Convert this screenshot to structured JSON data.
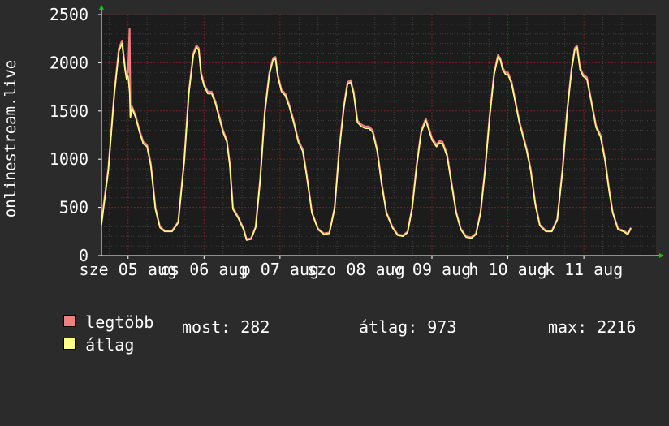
{
  "chart_data": {
    "type": "line",
    "ylabel": "onlinestream.live",
    "yticks": [
      0,
      500,
      1000,
      1500,
      2000,
      2500
    ],
    "ylim": [
      0,
      2500
    ],
    "xlim": [
      4.65,
      11.95
    ],
    "xtick_labels": [
      {
        "x": 5,
        "label": "sze 05 aug"
      },
      {
        "x": 6,
        "label": "cs 06 aug"
      },
      {
        "x": 7,
        "label": "p 07 aug"
      },
      {
        "x": 8,
        "label": "szo 08 aug"
      },
      {
        "x": 9,
        "label": "v 09 aug"
      },
      {
        "x": 10,
        "label": "h 10 aug"
      },
      {
        "x": 11,
        "label": "k 11 aug"
      }
    ],
    "grid": true,
    "colors": {
      "max": "#f08080",
      "avg": "#ffff88",
      "grid": "#7a2020",
      "axis": "#ffffff",
      "arrow": "#00cc00"
    },
    "series": [
      {
        "name": "legtöbb",
        "points": [
          [
            4.65,
            350
          ],
          [
            4.74,
            900
          ],
          [
            4.82,
            1700
          ],
          [
            4.88,
            2150
          ],
          [
            4.92,
            2230
          ],
          [
            4.96,
            1950
          ],
          [
            4.98,
            1850
          ],
          [
            5.0,
            1900
          ],
          [
            5.02,
            2350
          ],
          [
            5.03,
            1450
          ],
          [
            5.05,
            1550
          ],
          [
            5.1,
            1450
          ],
          [
            5.15,
            1300
          ],
          [
            5.2,
            1180
          ],
          [
            5.25,
            1150
          ],
          [
            5.3,
            950
          ],
          [
            5.36,
            500
          ],
          [
            5.42,
            300
          ],
          [
            5.48,
            260
          ],
          [
            5.58,
            260
          ],
          [
            5.66,
            350
          ],
          [
            5.74,
            1000
          ],
          [
            5.8,
            1700
          ],
          [
            5.86,
            2100
          ],
          [
            5.9,
            2180
          ],
          [
            5.93,
            2150
          ],
          [
            5.96,
            1900
          ],
          [
            6.0,
            1780
          ],
          [
            6.05,
            1700
          ],
          [
            6.1,
            1700
          ],
          [
            6.15,
            1600
          ],
          [
            6.2,
            1450
          ],
          [
            6.25,
            1300
          ],
          [
            6.3,
            1200
          ],
          [
            6.34,
            950
          ],
          [
            6.38,
            500
          ],
          [
            6.45,
            400
          ],
          [
            6.52,
            280
          ],
          [
            6.56,
            170
          ],
          [
            6.62,
            180
          ],
          [
            6.68,
            300
          ],
          [
            6.74,
            800
          ],
          [
            6.8,
            1500
          ],
          [
            6.86,
            1900
          ],
          [
            6.91,
            2050
          ],
          [
            6.94,
            2060
          ],
          [
            6.97,
            1880
          ],
          [
            7.02,
            1720
          ],
          [
            7.07,
            1680
          ],
          [
            7.12,
            1570
          ],
          [
            7.18,
            1400
          ],
          [
            7.24,
            1200
          ],
          [
            7.3,
            1100
          ],
          [
            7.35,
            850
          ],
          [
            7.42,
            450
          ],
          [
            7.5,
            280
          ],
          [
            7.58,
            230
          ],
          [
            7.65,
            240
          ],
          [
            7.72,
            500
          ],
          [
            7.78,
            1100
          ],
          [
            7.84,
            1550
          ],
          [
            7.89,
            1800
          ],
          [
            7.93,
            1820
          ],
          [
            7.97,
            1700
          ],
          [
            8.02,
            1400
          ],
          [
            8.07,
            1360
          ],
          [
            8.12,
            1340
          ],
          [
            8.17,
            1340
          ],
          [
            8.22,
            1300
          ],
          [
            8.28,
            1100
          ],
          [
            8.34,
            750
          ],
          [
            8.4,
            450
          ],
          [
            8.48,
            300
          ],
          [
            8.55,
            220
          ],
          [
            8.62,
            210
          ],
          [
            8.68,
            250
          ],
          [
            8.74,
            500
          ],
          [
            8.8,
            950
          ],
          [
            8.86,
            1300
          ],
          [
            8.92,
            1420
          ],
          [
            8.96,
            1320
          ],
          [
            9.0,
            1220
          ],
          [
            9.06,
            1150
          ],
          [
            9.1,
            1190
          ],
          [
            9.14,
            1180
          ],
          [
            9.2,
            1050
          ],
          [
            9.26,
            750
          ],
          [
            9.32,
            450
          ],
          [
            9.38,
            280
          ],
          [
            9.45,
            200
          ],
          [
            9.52,
            190
          ],
          [
            9.58,
            230
          ],
          [
            9.64,
            450
          ],
          [
            9.7,
            900
          ],
          [
            9.76,
            1450
          ],
          [
            9.82,
            1900
          ],
          [
            9.87,
            2080
          ],
          [
            9.9,
            2050
          ],
          [
            9.93,
            1950
          ],
          [
            9.97,
            1900
          ],
          [
            10.0,
            1900
          ],
          [
            10.05,
            1800
          ],
          [
            10.1,
            1600
          ],
          [
            10.15,
            1400
          ],
          [
            10.2,
            1250
          ],
          [
            10.25,
            1100
          ],
          [
            10.3,
            900
          ],
          [
            10.36,
            550
          ],
          [
            10.42,
            320
          ],
          [
            10.5,
            260
          ],
          [
            10.58,
            260
          ],
          [
            10.65,
            380
          ],
          [
            10.72,
            900
          ],
          [
            10.78,
            1500
          ],
          [
            10.84,
            1950
          ],
          [
            10.88,
            2150
          ],
          [
            10.91,
            2180
          ],
          [
            10.95,
            1950
          ],
          [
            10.99,
            1880
          ],
          [
            11.04,
            1850
          ],
          [
            11.1,
            1600
          ],
          [
            11.16,
            1350
          ],
          [
            11.22,
            1250
          ],
          [
            11.28,
            1000
          ],
          [
            11.33,
            700
          ],
          [
            11.38,
            450
          ],
          [
            11.45,
            280
          ],
          [
            11.52,
            260
          ],
          [
            11.58,
            230
          ],
          [
            11.62,
            290
          ]
        ]
      },
      {
        "name": "átlag",
        "points": [
          [
            4.65,
            320
          ],
          [
            4.74,
            880
          ],
          [
            4.82,
            1680
          ],
          [
            4.88,
            2120
          ],
          [
            4.92,
            2200
          ],
          [
            4.96,
            1930
          ],
          [
            4.98,
            1830
          ],
          [
            5.0,
            1870
          ],
          [
            5.02,
            1700
          ],
          [
            5.03,
            1430
          ],
          [
            5.05,
            1530
          ],
          [
            5.1,
            1430
          ],
          [
            5.15,
            1280
          ],
          [
            5.2,
            1160
          ],
          [
            5.25,
            1130
          ],
          [
            5.3,
            930
          ],
          [
            5.36,
            480
          ],
          [
            5.42,
            290
          ],
          [
            5.48,
            250
          ],
          [
            5.58,
            250
          ],
          [
            5.66,
            340
          ],
          [
            5.74,
            980
          ],
          [
            5.8,
            1680
          ],
          [
            5.86,
            2080
          ],
          [
            5.9,
            2160
          ],
          [
            5.93,
            2130
          ],
          [
            5.96,
            1880
          ],
          [
            6.0,
            1760
          ],
          [
            6.05,
            1680
          ],
          [
            6.1,
            1680
          ],
          [
            6.15,
            1580
          ],
          [
            6.2,
            1430
          ],
          [
            6.25,
            1280
          ],
          [
            6.3,
            1180
          ],
          [
            6.34,
            930
          ],
          [
            6.38,
            480
          ],
          [
            6.45,
            390
          ],
          [
            6.52,
            270
          ],
          [
            6.56,
            160
          ],
          [
            6.62,
            170
          ],
          [
            6.68,
            290
          ],
          [
            6.74,
            780
          ],
          [
            6.8,
            1480
          ],
          [
            6.86,
            1880
          ],
          [
            6.91,
            2030
          ],
          [
            6.94,
            2040
          ],
          [
            6.97,
            1860
          ],
          [
            7.02,
            1700
          ],
          [
            7.07,
            1660
          ],
          [
            7.12,
            1550
          ],
          [
            7.18,
            1380
          ],
          [
            7.24,
            1180
          ],
          [
            7.3,
            1080
          ],
          [
            7.35,
            830
          ],
          [
            7.42,
            440
          ],
          [
            7.5,
            270
          ],
          [
            7.58,
            220
          ],
          [
            7.65,
            230
          ],
          [
            7.72,
            490
          ],
          [
            7.78,
            1080
          ],
          [
            7.84,
            1530
          ],
          [
            7.89,
            1780
          ],
          [
            7.93,
            1800
          ],
          [
            7.97,
            1680
          ],
          [
            8.02,
            1380
          ],
          [
            8.07,
            1340
          ],
          [
            8.12,
            1320
          ],
          [
            8.17,
            1320
          ],
          [
            8.22,
            1280
          ],
          [
            8.28,
            1080
          ],
          [
            8.34,
            730
          ],
          [
            8.4,
            440
          ],
          [
            8.48,
            290
          ],
          [
            8.55,
            210
          ],
          [
            8.62,
            200
          ],
          [
            8.68,
            240
          ],
          [
            8.74,
            490
          ],
          [
            8.8,
            930
          ],
          [
            8.86,
            1280
          ],
          [
            8.92,
            1400
          ],
          [
            8.96,
            1300
          ],
          [
            9.0,
            1200
          ],
          [
            9.06,
            1130
          ],
          [
            9.1,
            1170
          ],
          [
            9.14,
            1160
          ],
          [
            9.2,
            1030
          ],
          [
            9.26,
            730
          ],
          [
            9.32,
            440
          ],
          [
            9.38,
            270
          ],
          [
            9.45,
            190
          ],
          [
            9.52,
            180
          ],
          [
            9.58,
            220
          ],
          [
            9.64,
            440
          ],
          [
            9.7,
            880
          ],
          [
            9.76,
            1430
          ],
          [
            9.82,
            1880
          ],
          [
            9.87,
            2060
          ],
          [
            9.9,
            2030
          ],
          [
            9.93,
            1930
          ],
          [
            9.97,
            1880
          ],
          [
            10.0,
            1880
          ],
          [
            10.05,
            1780
          ],
          [
            10.1,
            1580
          ],
          [
            10.15,
            1380
          ],
          [
            10.2,
            1230
          ],
          [
            10.25,
            1080
          ],
          [
            10.3,
            880
          ],
          [
            10.36,
            530
          ],
          [
            10.42,
            310
          ],
          [
            10.5,
            250
          ],
          [
            10.58,
            250
          ],
          [
            10.65,
            370
          ],
          [
            10.72,
            880
          ],
          [
            10.78,
            1480
          ],
          [
            10.84,
            1930
          ],
          [
            10.88,
            2130
          ],
          [
            10.91,
            2160
          ],
          [
            10.95,
            1930
          ],
          [
            10.99,
            1860
          ],
          [
            11.04,
            1830
          ],
          [
            11.1,
            1580
          ],
          [
            11.16,
            1330
          ],
          [
            11.22,
            1230
          ],
          [
            11.28,
            980
          ],
          [
            11.33,
            680
          ],
          [
            11.38,
            440
          ],
          [
            11.45,
            270
          ],
          [
            11.52,
            250
          ],
          [
            11.58,
            220
          ],
          [
            11.62,
            282
          ]
        ]
      }
    ]
  },
  "legend": {
    "max_label": "legtöbb",
    "avg_label": "átlag",
    "now": "most: 282",
    "average": "átlag: 973",
    "max": "max: 2216"
  }
}
